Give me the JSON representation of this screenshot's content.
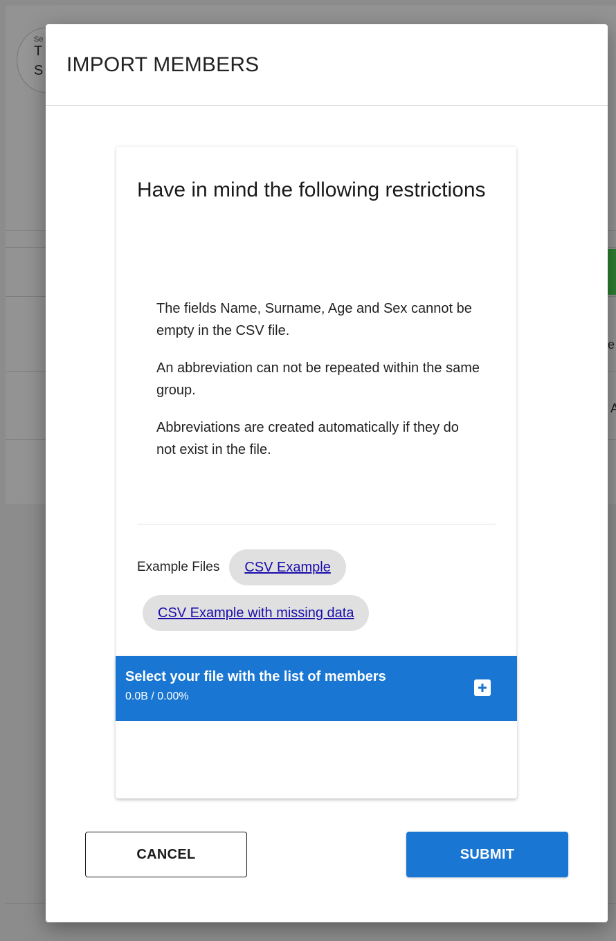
{
  "background": {
    "circle_small": "Se",
    "circle_line1": "T",
    "circle_line2": "S",
    "frag_right_1": "e",
    "frag_right_2": "A"
  },
  "dialog": {
    "title": "IMPORT MEMBERS"
  },
  "restrictions": {
    "title": "Have in mind the following restrictions",
    "items": [
      "The fields Name, Surname, Age and Sex cannot be empty in the CSV file.",
      "An abbreviation can not be repeated within the same group.",
      "Abbreviations are created automatically if they do not exist in the file."
    ]
  },
  "examples": {
    "label": "Example Files",
    "links": [
      "CSV Example",
      "CSV Example with missing data"
    ]
  },
  "file_select": {
    "title": "Select your file with the list of members",
    "size": "0.0B / 0.00%",
    "add_icon": "plus-box-icon"
  },
  "actions": {
    "cancel_label": "CANCEL",
    "submit_label": "SUBMIT"
  },
  "colors": {
    "primary": "#1976d2",
    "overlay": "#8c8c8c",
    "chip": "#e0e0e0",
    "link": "#1a0dab",
    "background_accent": "#2e7d32"
  }
}
